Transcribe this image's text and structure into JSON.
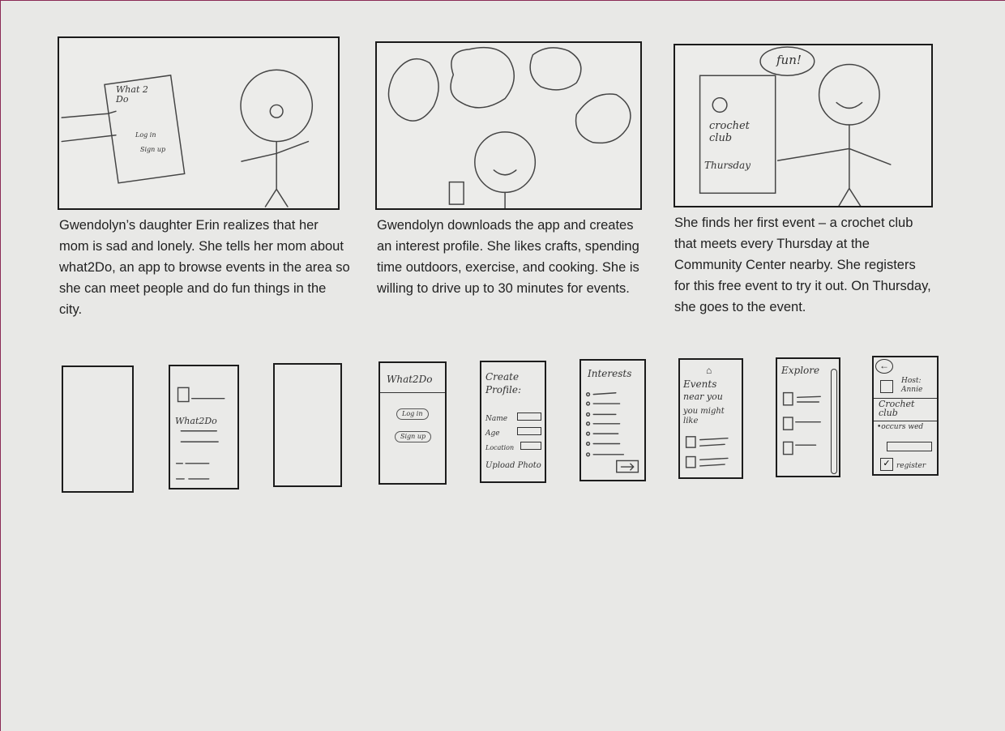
{
  "panels": [
    {
      "caption": "Gwendolyn’s daughter Erin realizes that her mom is sad and lonely. She tells her mom about what2Do, an app to browse events in the area so she can meet people and do fun things in the city.",
      "sketch_text": {
        "app_title": "What 2 Do",
        "login": "Log in",
        "signup": "Sign up"
      }
    },
    {
      "caption": "Gwendolyn downloads the app and creates an interest profile. She likes crafts, spending time outdoors, exercise, and cooking. She is willing to drive up to 30 minutes for events.",
      "sketch_text": {}
    },
    {
      "caption": "She finds her first event – a crochet club that meets every Thursday at the Community Center nearby. She registers for this free event to try it out. On Thursday, she goes to the event.",
      "sketch_text": {
        "bubble": "fun!",
        "club": "crochet club",
        "day": "Thursday"
      }
    }
  ],
  "screens": [
    {
      "lines": []
    },
    {
      "lines": [
        "What2Do"
      ]
    },
    {
      "lines": []
    },
    {
      "lines": [
        "What2Do",
        "Log in",
        "Sign up"
      ]
    },
    {
      "lines": [
        "Create Profile:",
        "Name",
        "Age",
        "Location",
        "Upload Photo"
      ]
    },
    {
      "lines": [
        "Interests"
      ]
    },
    {
      "lines": [
        "Events",
        "near you",
        "you might like"
      ]
    },
    {
      "lines": [
        "Explore"
      ]
    },
    {
      "lines": [
        "Host: Annie",
        "Crochet club",
        "•occurs wed",
        "register"
      ]
    }
  ]
}
